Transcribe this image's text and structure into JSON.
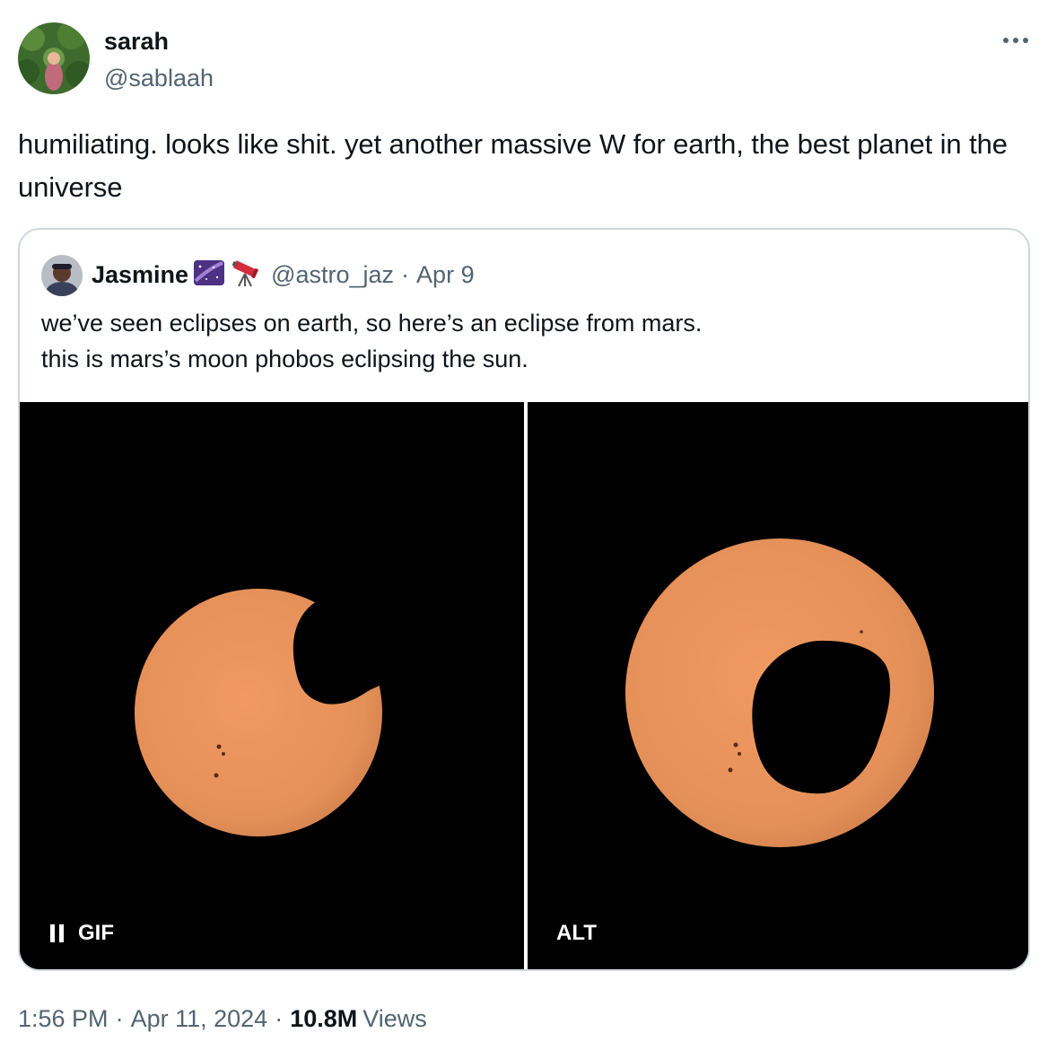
{
  "author": {
    "name": "sarah",
    "handle": "@sablaah"
  },
  "more_icon": "more-horizontal-icon",
  "tweet_text": "humiliating. looks like shit. yet another massive W for earth, the best planet in the universe",
  "quote": {
    "name": "Jasmine",
    "emoji_icons": [
      "milky-way-icon",
      "telescope-icon"
    ],
    "handle": "@astro_jaz",
    "separator": "·",
    "date": "Apr 9",
    "text_line1": "we’ve seen eclipses on earth, so here’s an eclipse from mars.",
    "text_line2": "this is mars’s moon phobos eclipsing the sun.",
    "media": {
      "gif_label": "GIF",
      "alt_label": "ALT",
      "sun_color": "#eb9560",
      "background_color": "#000000"
    }
  },
  "footer": {
    "time": "1:56 PM",
    "separator": "·",
    "date": "Apr 11, 2024",
    "views_count": "10.8M",
    "views_label": "Views"
  },
  "colors": {
    "text": "#0f1419",
    "secondary": "#536471",
    "border": "#cfd9de"
  }
}
